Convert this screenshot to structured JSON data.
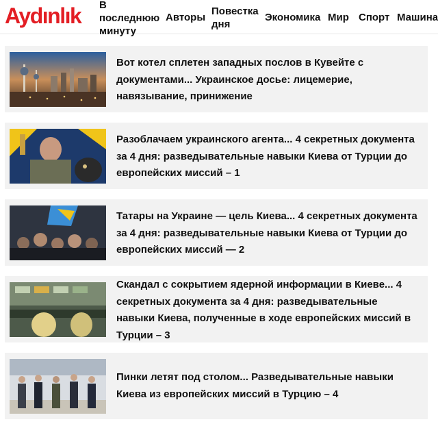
{
  "header": {
    "logo_text": "Aydınlık",
    "nav": [
      {
        "label": "В последнюю минуту"
      },
      {
        "label": "Авторы"
      },
      {
        "label": "Повестка дня"
      },
      {
        "label": "Экономика"
      },
      {
        "label": "Мир"
      },
      {
        "label": "Спорт"
      },
      {
        "label": "Машина"
      }
    ]
  },
  "articles": [
    {
      "title": "Вот котел сплетен западных послов в Кувейте с документами... Украинское досье: лицемерие, навязывание, принижение",
      "thumb_icon": "city-skyline-image"
    },
    {
      "title": "Разоблачаем украинского агента... 4 секретных документа за 4 дня: разведывательные навыки Киева от Турции до европейских миссий – 1",
      "thumb_icon": "soldier-portrait-image"
    },
    {
      "title": "Татары на Украине — цель Киева... 4 секретных документа за 4 дня: разведывательные навыки Киева от Турции до европейских миссий — 2",
      "thumb_icon": "crowd-protest-image"
    },
    {
      "title": "Скандал с сокрытием ядерной информации в Киеве... 4 секретных документа за 4 дня: разведывательные навыки Киева, полученные в ходе европейских миссий в Турции – 3",
      "thumb_icon": "control-room-image"
    },
    {
      "title": "Пинки летят под столом... Разведывательные навыки Киева из европейских миссий в Турцию – 4",
      "thumb_icon": "officials-walking-image"
    }
  ],
  "colors": {
    "brand": "#e31e24",
    "card_bg": "#f2f2f2",
    "text": "#111111"
  }
}
